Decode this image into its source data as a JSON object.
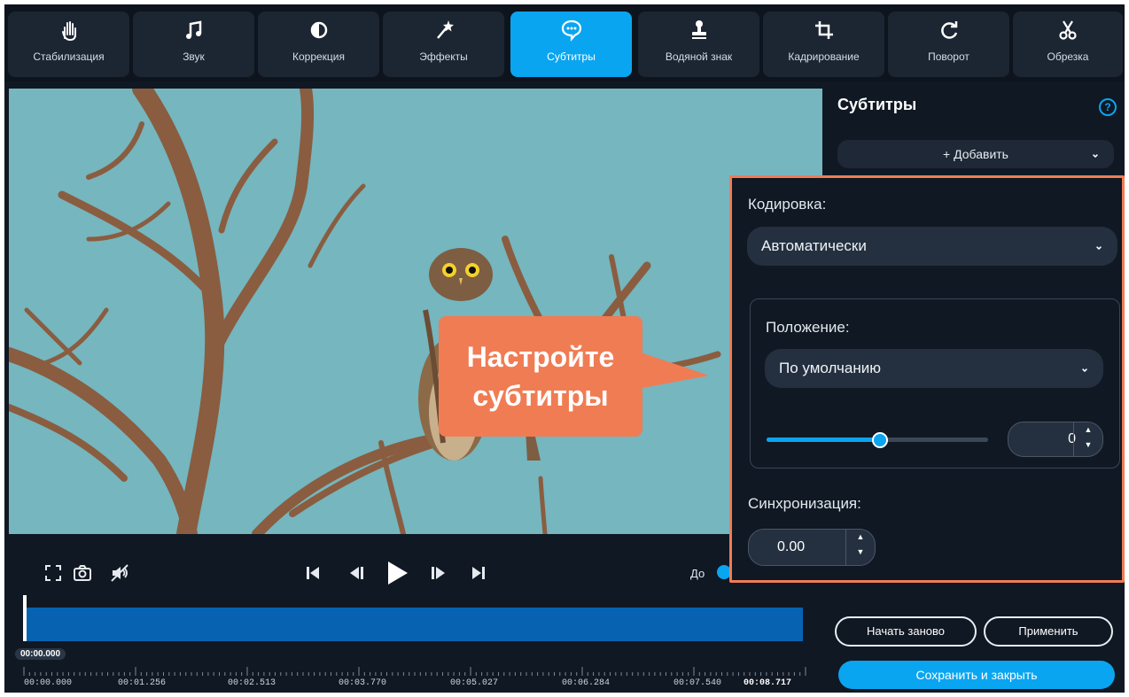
{
  "toolbar": {
    "tools": [
      {
        "label": "Стабилизация",
        "icon": "hand-icon"
      },
      {
        "label": "Звук",
        "icon": "music-note-icon"
      },
      {
        "label": "Коррекция",
        "icon": "contrast-icon"
      },
      {
        "label": "Эффекты",
        "icon": "magic-wand-icon"
      },
      {
        "label": "Субтитры",
        "icon": "speech-bubble-icon",
        "active": true
      },
      {
        "label": "Водяной знак",
        "icon": "stamp-icon"
      },
      {
        "label": "Кадрирование",
        "icon": "crop-icon"
      },
      {
        "label": "Поворот",
        "icon": "rotate-icon"
      },
      {
        "label": "Обрезка",
        "icon": "scissors-icon"
      }
    ]
  },
  "player": {
    "before_label": "До",
    "current_time": "00:00.000",
    "ticks": [
      "00:00.000",
      "00:01.256",
      "00:02.513",
      "00:03.770",
      "00:05.027",
      "00:06.284",
      "00:07.540",
      "00:08.717"
    ]
  },
  "panel": {
    "title": "Субтитры",
    "add_label": "+ Добавить",
    "encoding_label": "Кодировка:",
    "encoding_value": "Автоматически",
    "position_label": "Положение:",
    "position_value": "По умолчанию",
    "offset_value": "0",
    "offset_slider_fraction": 0.51,
    "sync_label": "Синхронизация:",
    "sync_value": "0.00",
    "reset_label": "Начать заново",
    "apply_label": "Применить",
    "save_label": "Сохранить и закрыть"
  },
  "callout": {
    "line1": "Настройте",
    "line2": "субтитры"
  },
  "colors": {
    "accent": "#0aa5f0",
    "highlight": "#f07c54",
    "timeline": "#0763b2"
  }
}
